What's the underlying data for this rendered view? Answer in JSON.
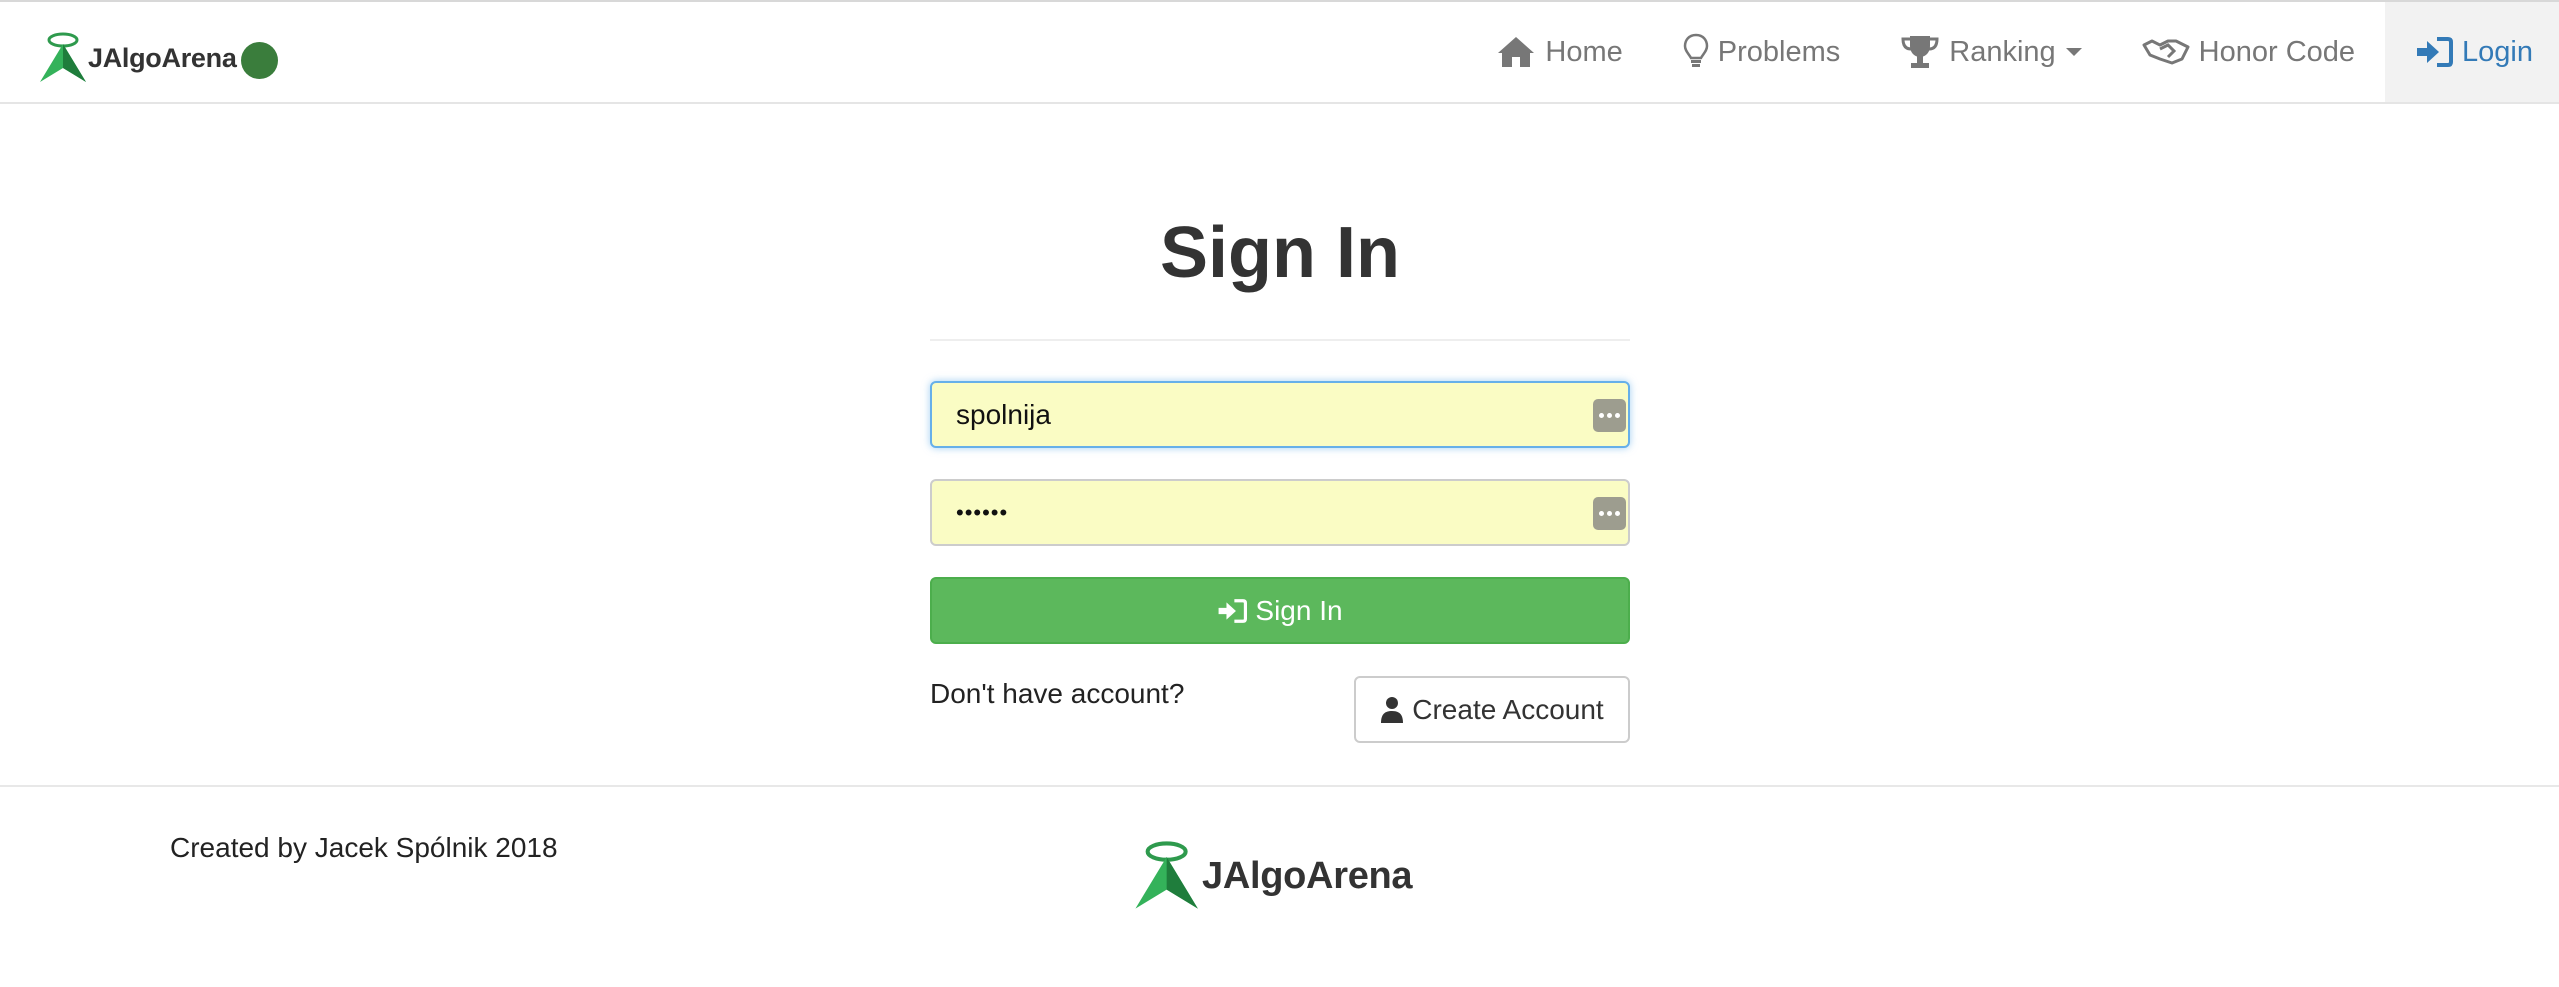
{
  "nav": {
    "brand": "JAlgoArena",
    "items": [
      {
        "label": "Home",
        "icon": "home-icon"
      },
      {
        "label": "Problems",
        "icon": "lightbulb-icon"
      },
      {
        "label": "Ranking",
        "icon": "trophy-icon"
      },
      {
        "label": "Honor Code",
        "icon": "handshake-icon"
      },
      {
        "label": "Login",
        "icon": "sign-in-icon"
      }
    ],
    "active_item": "Login",
    "status_color": "#3a7d3c"
  },
  "form": {
    "title": "Sign In",
    "username_value": "spolnija",
    "password_value": "••••••",
    "submit_label": "Sign In",
    "no_account_text": "Don't have account?",
    "create_label": "Create Account"
  },
  "footer": {
    "credit": "Created by Jacek Spólnik 2018",
    "brand": "JAlgoArena"
  },
  "colors": {
    "primary_green": "#5cb85c",
    "link_blue": "#337ab7",
    "autofill_yellow": "#fafcc4"
  }
}
